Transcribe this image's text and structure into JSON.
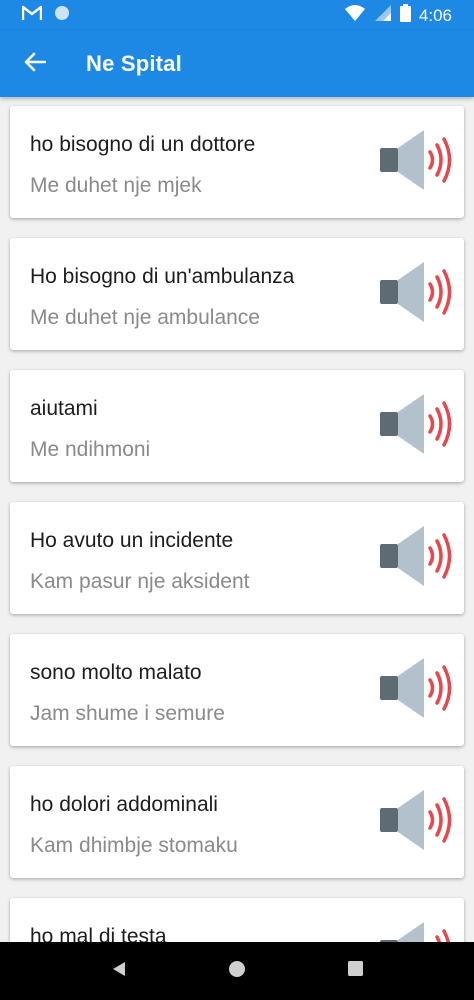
{
  "status_bar": {
    "time": "4:06",
    "icons": [
      "gmail-icon",
      "circle-notification-icon",
      "wifi-icon",
      "signal-icon",
      "battery-icon"
    ]
  },
  "app_bar": {
    "title": "Ne Spital",
    "back_icon": "arrow-back-icon"
  },
  "phrases": [
    {
      "it": "ho bisogno di un dottore",
      "sq": "Me duhet nje mjek"
    },
    {
      "it": "Ho bisogno di un'ambulanza",
      "sq": "Me duhet nje ambulance"
    },
    {
      "it": "aiutami",
      "sq": "Me ndihmoni"
    },
    {
      "it": "Ho avuto un incidente",
      "sq": "Kam pasur nje aksident"
    },
    {
      "it": "sono molto malato",
      "sq": "Jam shume i semure"
    },
    {
      "it": "ho dolori addominali",
      "sq": "Kam dhimbje stomaku"
    },
    {
      "it": "ho mal di testa",
      "sq": ""
    }
  ],
  "nav_bar": {
    "icons": [
      "back-triangle-icon",
      "home-circle-icon",
      "recents-square-icon"
    ]
  },
  "colors": {
    "primary": "#1e88e5",
    "speaker_body": "#5f6b73",
    "speaker_cone": "#b3c1cc",
    "sound_waves": "#e5484d"
  }
}
